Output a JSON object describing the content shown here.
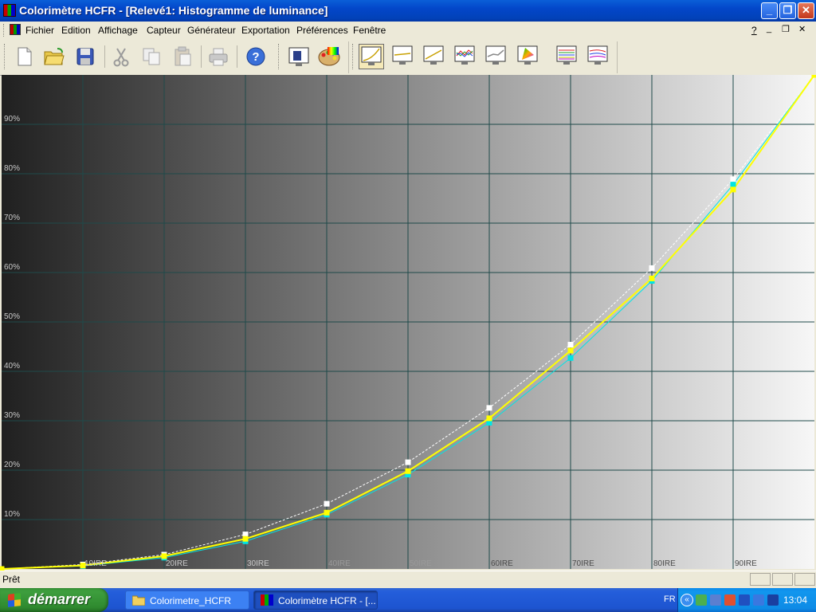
{
  "window": {
    "title": "Colorimètre HCFR - [Relevé1: Histogramme de luminance]",
    "min_glyph": "_",
    "max_glyph": "❐",
    "close_glyph": "✕"
  },
  "menu": {
    "items": [
      "Fichier",
      "Edition",
      "Affichage",
      "Capteur",
      "Générateur",
      "Exportation",
      "Préférences",
      "Fenêtre"
    ],
    "help": "?",
    "mdi_min": "_",
    "mdi_restore": "❐",
    "mdi_close": "✕"
  },
  "toolbar": {
    "standard": [
      "new-icon",
      "open-icon",
      "save-icon",
      "cut-icon",
      "copy-icon",
      "paste-icon",
      "print-icon",
      "help-icon"
    ],
    "measure": [
      "measure-window-icon",
      "palette-icon"
    ],
    "views": [
      "luminance-view-icon",
      "gamma-view-icon",
      "near-black-view-icon",
      "rgb-levels-view-icon",
      "color-temp-view-icon",
      "cie-chart-view-icon",
      "saturation-view-icon",
      "saturation-shift-view-icon"
    ],
    "active_view": 0
  },
  "chart_data": {
    "type": "line",
    "title": "",
    "x": [
      0,
      10,
      20,
      30,
      40,
      50,
      60,
      70,
      80,
      90,
      100
    ],
    "x_tick_labels": [
      "10IRE",
      "20IRE",
      "30IRE",
      "40IRE",
      "50IRE",
      "60IRE",
      "70IRE",
      "80IRE",
      "90IRE"
    ],
    "y_tick_labels": [
      "10%",
      "20%",
      "30%",
      "40%",
      "50%",
      "60%",
      "70%",
      "80%",
      "90%"
    ],
    "ylim": [
      0,
      100
    ],
    "xlim": [
      0,
      100
    ],
    "grid": true,
    "background": "grayscale ramp 0–100 IRE",
    "series": [
      {
        "color": "#ffff00",
        "style": "solid",
        "values": [
          0,
          0.7,
          2.6,
          6.1,
          11.4,
          19.8,
          30.5,
          44.2,
          58.8,
          76.8,
          100
        ]
      },
      {
        "color": "#00e5e5",
        "style": "solid",
        "values": [
          0,
          0.6,
          2.3,
          5.6,
          11.0,
          19.1,
          29.6,
          42.7,
          58.3,
          77.8,
          100
        ]
      },
      {
        "color": "#ffffff",
        "style": "dashed",
        "values": [
          0,
          0.9,
          2.9,
          7.0,
          13.2,
          21.6,
          32.6,
          45.4,
          60.9,
          78.9,
          100
        ]
      }
    ]
  },
  "status": {
    "text": "Prêt"
  },
  "taskbar": {
    "start_label": "démarrer",
    "tasks": [
      "Colorimetre_HCFR",
      "Colorimètre HCFR - [..."
    ],
    "lang": "FR",
    "chevron": "«",
    "clock": "13:04"
  }
}
